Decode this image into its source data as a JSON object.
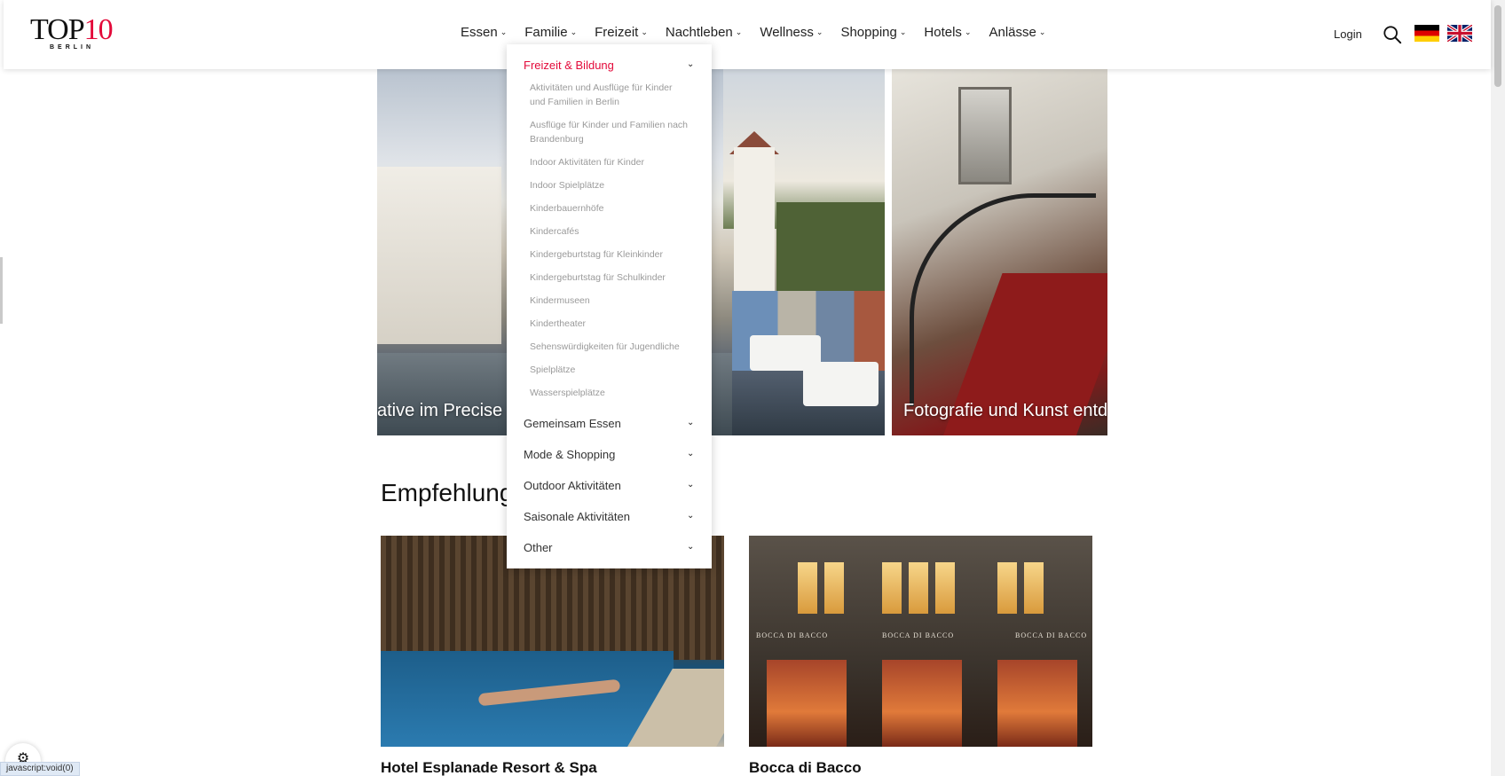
{
  "header": {
    "logo_text_main": "TOP",
    "logo_text_num": "10",
    "logo_sub": "BERLIN",
    "nav": [
      "Essen",
      "Familie",
      "Freizeit",
      "Nachtleben",
      "Wellness",
      "Shopping",
      "Hotels",
      "Anlässe"
    ],
    "login": "Login",
    "search_icon": "search-icon",
    "flags": [
      "german-flag-icon",
      "uk-flag-icon"
    ]
  },
  "hero": {
    "caption_left": "ative im Precise Re",
    "caption_right": "Fotografie und Kunst entdec"
  },
  "dropdown": {
    "sections": [
      "Freizeit & Bildung",
      "Gemeinsam Essen",
      "Mode & Shopping",
      "Outdoor Aktivitäten",
      "Saisonale Aktivitäten",
      "Other"
    ],
    "items": [
      "Aktivitäten und Ausflüge für Kinder und Familien in Berlin",
      "Ausflüge für Kinder und Familien nach Brandenburg",
      "Indoor Aktivitäten für Kinder",
      "Indoor Spielplätze",
      "Kinderbauernhöfe",
      "Kindercafés",
      "Kindergeburtstag für Kleinkinder",
      "Kindergeburtstag für Schulkinder",
      "Kindermuseen",
      "Kindertheater",
      "Sehenswürdigkeiten für Jugendliche",
      "Spielplätze",
      "Wasserspielplätze"
    ]
  },
  "section": {
    "title": "Empfehlungen",
    "cards": [
      {
        "title": "Hotel Esplanade Resort & Spa"
      },
      {
        "title": "Bocca di Bacco",
        "sign": "BOCCA DI BACCO"
      }
    ]
  },
  "status_bar": "javascript:void(0)",
  "colors": {
    "accent": "#e30a3a",
    "text": "#222222",
    "muted": "#9a9a9a"
  }
}
